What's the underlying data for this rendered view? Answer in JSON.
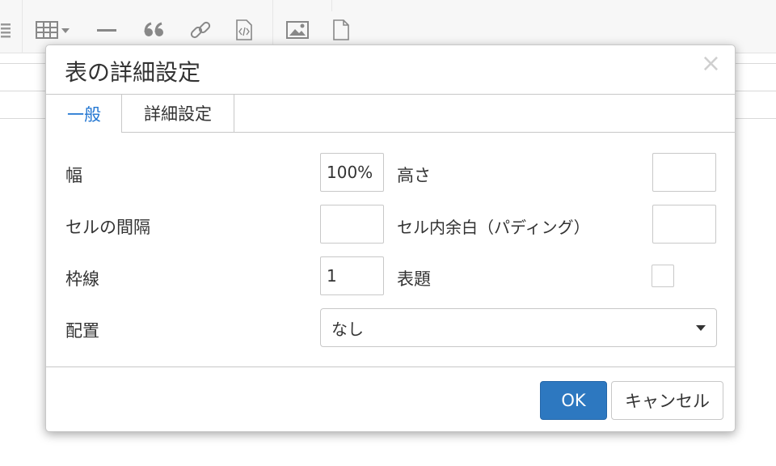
{
  "colors": {
    "accent": "#2276d2",
    "primary_button": "#2d78c0",
    "border": "#c8c8c8"
  },
  "toolbar": {
    "icons": [
      "list-icon",
      "table-icon",
      "horizontal-rule-icon",
      "blockquote-icon",
      "link-icon",
      "code-view-icon",
      "image-icon",
      "file-icon"
    ]
  },
  "dialog": {
    "title": "表の詳細設定",
    "close_glyph": "×",
    "tabs": [
      {
        "label": "一般",
        "active": true
      },
      {
        "label": "詳細設定",
        "active": false
      }
    ],
    "fields": {
      "width": {
        "label": "幅",
        "value": "100%"
      },
      "height": {
        "label": "高さ",
        "value": ""
      },
      "cell_spacing": {
        "label": "セルの間隔",
        "value": ""
      },
      "cell_padding": {
        "label": "セル内余白（パディング）",
        "value": ""
      },
      "border": {
        "label": "枠線",
        "value": "1"
      },
      "caption": {
        "label": "表題",
        "checked": false
      },
      "alignment": {
        "label": "配置",
        "value": "なし"
      }
    },
    "ok_label": "OK",
    "cancel_label": "キャンセル"
  }
}
